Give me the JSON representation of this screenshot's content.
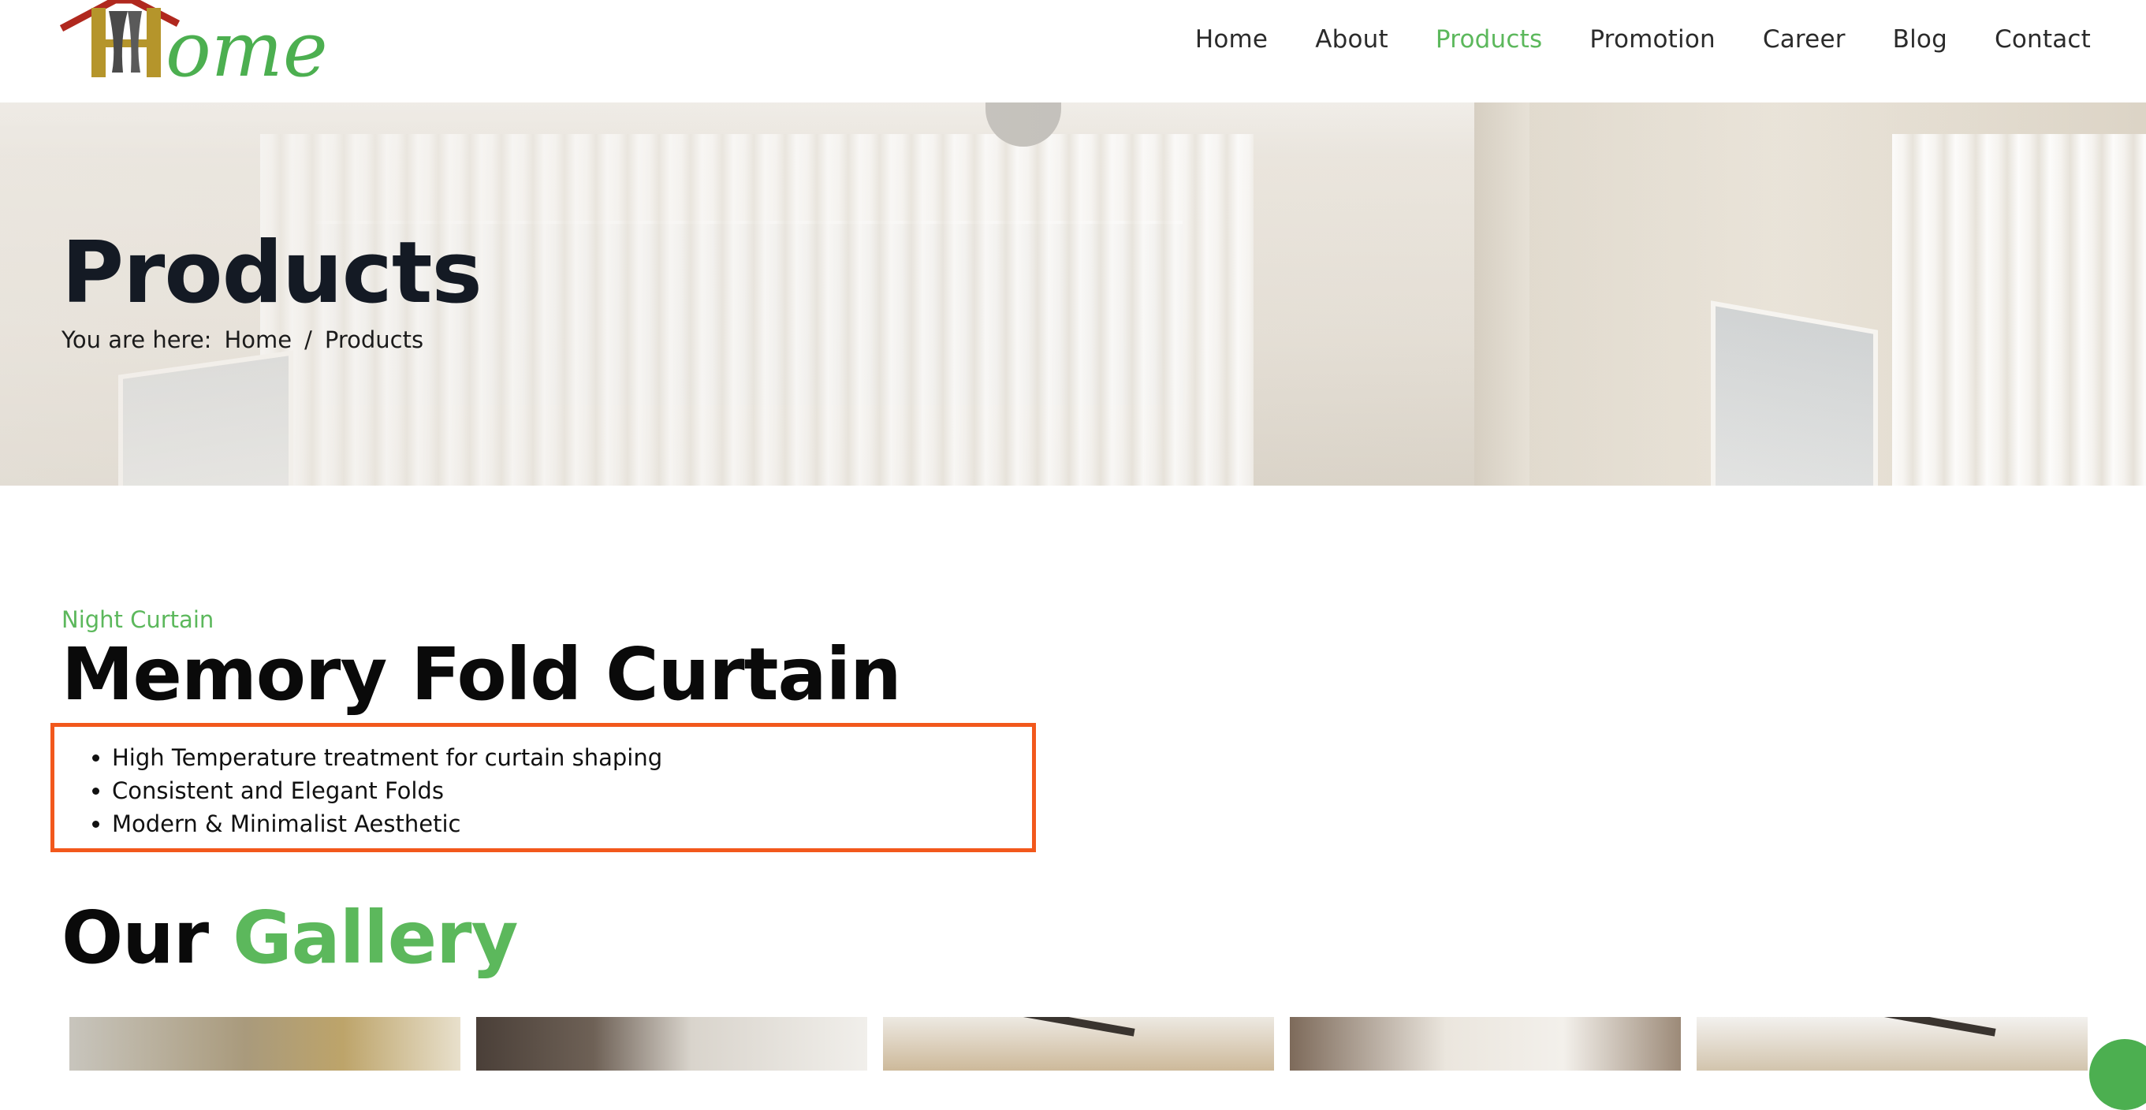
{
  "logo": {
    "text": "Home",
    "icon": "house-roof-curtain-logo"
  },
  "nav": {
    "items": [
      {
        "label": "Home",
        "active": false
      },
      {
        "label": "About",
        "active": false
      },
      {
        "label": "Products",
        "active": true
      },
      {
        "label": "Promotion",
        "active": false
      },
      {
        "label": "Career",
        "active": false
      },
      {
        "label": "Blog",
        "active": false
      },
      {
        "label": "Contact",
        "active": false
      }
    ]
  },
  "hero": {
    "title": "Products",
    "breadcrumb": {
      "prefix": "You are here:",
      "home": "Home",
      "separator": "/",
      "current": "Products"
    }
  },
  "product": {
    "category": "Night Curtain",
    "title": "Memory Fold Curtain",
    "features": [
      "High Temperature treatment for curtain shaping",
      "Consistent and Elegant Folds",
      "Modern & Minimalist Aesthetic"
    ]
  },
  "gallery": {
    "title_part1": "Our",
    "title_part2": "Gallery",
    "thumbnails": [
      "curtain-room-photo",
      "wardrobe-room-photo",
      "ceiling-room-photo",
      "bedroom-photo",
      "fan-room-photo"
    ]
  },
  "colors": {
    "accent_green": "#5cb85c",
    "highlight_orange": "#f2581c",
    "heading_dark": "#141a24"
  }
}
